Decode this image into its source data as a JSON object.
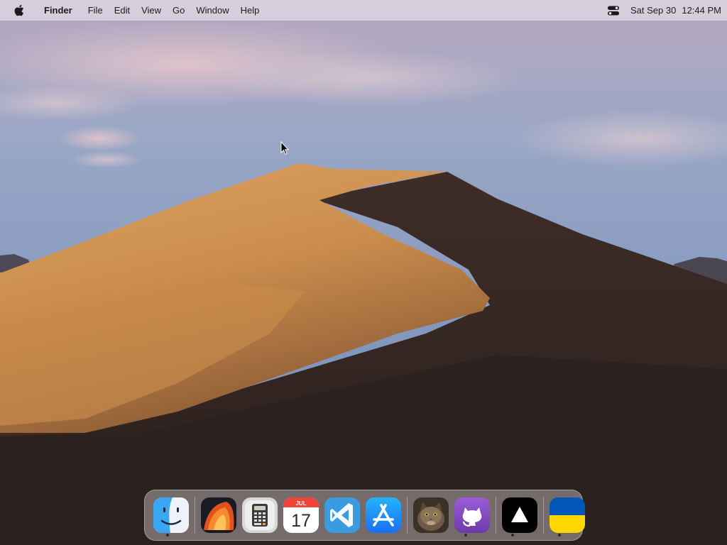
{
  "menubar": {
    "apple_icon": "apple-logo-icon",
    "app_name": "Finder",
    "menus": [
      "File",
      "Edit",
      "View",
      "Go",
      "Window",
      "Help"
    ],
    "control_center_icon": "control-center-icon",
    "date": "Sat Sep 30",
    "time": "12:44 PM"
  },
  "desktop": {
    "wallpaper": "macOS Mojave desert dune"
  },
  "dock": {
    "items": [
      {
        "name": "finder",
        "icon": "finder-icon",
        "running": true
      },
      {
        "name": "ventura-wallpaper",
        "icon": "ventura-icon",
        "running": false
      },
      {
        "name": "calculator",
        "icon": "calculator-icon",
        "running": false
      },
      {
        "name": "calendar",
        "icon": "calendar-icon",
        "running": false,
        "month": "JUL",
        "day": "17"
      },
      {
        "name": "vscode",
        "icon": "vscode-icon",
        "running": false
      },
      {
        "name": "app-store",
        "icon": "app-store-icon",
        "running": false
      },
      {
        "name": "cat-photo",
        "icon": "cat-photo-icon",
        "running": false
      },
      {
        "name": "github",
        "icon": "github-icon",
        "running": true
      },
      {
        "name": "vercel",
        "icon": "vercel-triangle-icon",
        "running": true
      },
      {
        "name": "ukraine-flag",
        "icon": "ukraine-flag-icon",
        "running": true
      }
    ]
  },
  "colors": {
    "sky_top": "#c6b3c6",
    "sky_mid": "#8fa3c8",
    "dune_light": "#d39a55",
    "dune_shadow": "#3a2a24",
    "ukraine_blue": "#0057b7",
    "ukraine_yellow": "#ffd700"
  }
}
